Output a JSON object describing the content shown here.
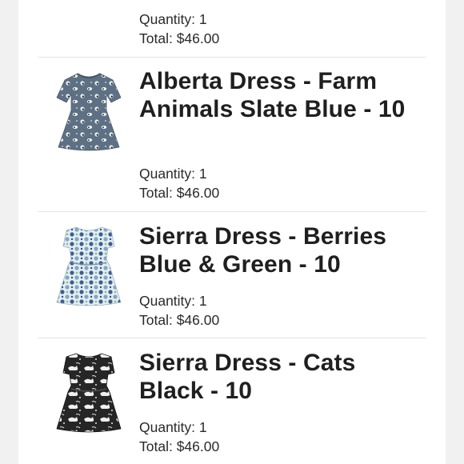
{
  "cart": {
    "partial": {
      "quantity": "Quantity: 1",
      "total": "Total: $46.00"
    },
    "items": [
      {
        "title": "Alberta Dress - Farm Animals Slate Blue - 10",
        "quantity": "Quantity: 1",
        "total": "Total: $46.00",
        "image": "dress-farm-animals-slate-blue",
        "color": "#5c6e80"
      },
      {
        "title": "Sierra Dress - Berries Blue & Green - 10",
        "quantity": "Quantity: 1",
        "total": "Total: $46.00",
        "image": "dress-berries-blue-green",
        "color": "#dfe9ef"
      },
      {
        "title": "Sierra Dress - Cats Black - 10",
        "quantity": "Quantity: 1",
        "total": "Total: $46.00",
        "image": "dress-cats-black",
        "color": "#262626"
      }
    ]
  }
}
